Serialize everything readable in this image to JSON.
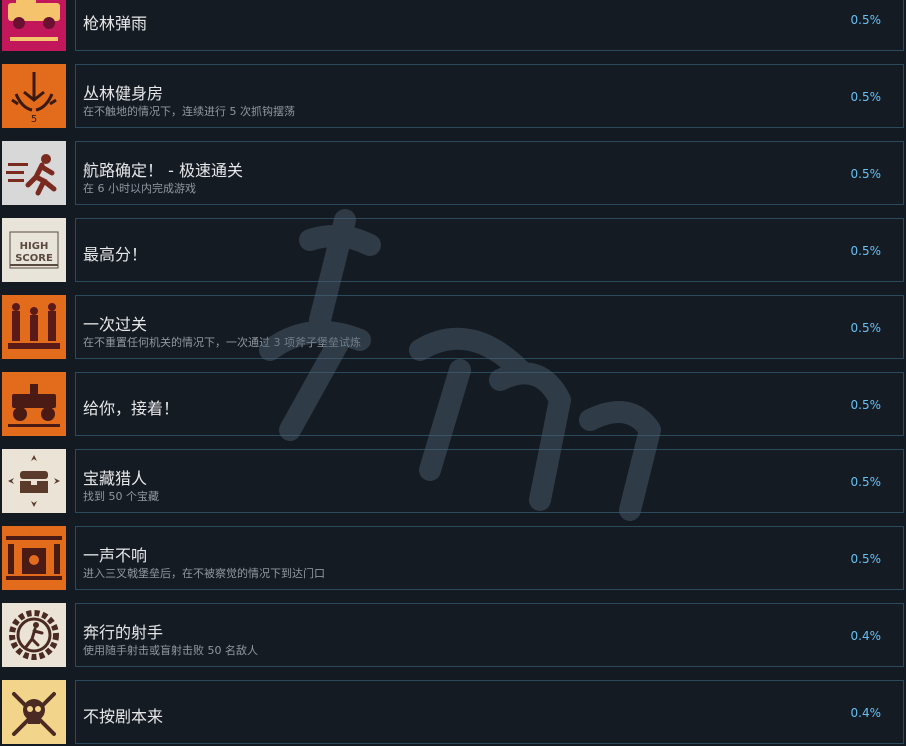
{
  "achievements": [
    {
      "title": "枪林弹雨",
      "desc": "",
      "pct": "0.5%",
      "icon": "armored-car-icon",
      "bg": "#c2185b"
    },
    {
      "title": "丛林健身房",
      "desc": "在不触地的情况下，连续进行 5 次抓钩摆荡",
      "pct": "0.5%",
      "icon": "grappling-hook-icon",
      "bg": "#e36b1c"
    },
    {
      "title": "航路确定！ - 极速通关",
      "desc": "在 6 小时以内完成游戏",
      "pct": "0.5%",
      "icon": "running-man-icon",
      "bg": "#d8d8d8"
    },
    {
      "title": "最高分！",
      "desc": "",
      "pct": "0.5%",
      "icon": "high-score-icon",
      "bg": "#e9e4da"
    },
    {
      "title": "一次过关",
      "desc": "在不重置任何机关的情况下，一次通过 3 项斧子堡垒试炼",
      "pct": "0.5%",
      "icon": "statues-icon",
      "bg": "#e36b1c"
    },
    {
      "title": "给你，接着！",
      "desc": "",
      "pct": "0.5%",
      "icon": "buggy-icon",
      "bg": "#e36b1c"
    },
    {
      "title": "宝藏猎人",
      "desc": "找到 50 个宝藏",
      "pct": "0.5%",
      "icon": "treasure-chest-icon",
      "bg": "#ebe4d6"
    },
    {
      "title": "一声不响",
      "desc": "进入三叉戟堡垒后，在不被察觉的情况下到达门口",
      "pct": "0.5%",
      "icon": "fortress-gate-icon",
      "bg": "#e36b1c"
    },
    {
      "title": "奔行的射手",
      "desc": "使用随手射击或盲射击败 50 名敌人",
      "pct": "0.4%",
      "icon": "shooter-icon",
      "bg": "#ebe4d6"
    },
    {
      "title": "不按剧本来",
      "desc": "",
      "pct": "0.4%",
      "icon": "skull-crossbones-icon",
      "bg": "#f2d58a"
    }
  ]
}
